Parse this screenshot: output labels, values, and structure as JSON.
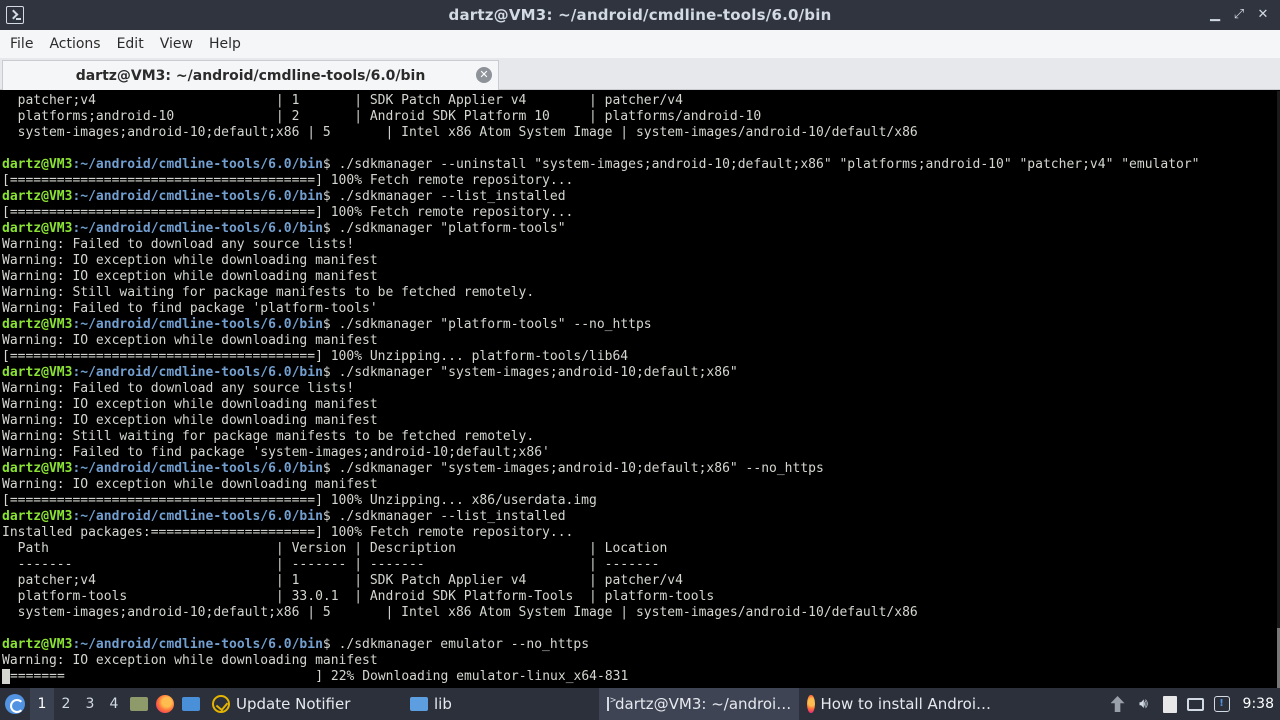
{
  "window": {
    "title": "dartz@VM3: ~/android/cmdline-tools/6.0/bin"
  },
  "menu": {
    "file": "File",
    "actions": "Actions",
    "edit": "Edit",
    "view": "View",
    "help": "Help"
  },
  "tab": {
    "label": "dartz@VM3: ~/android/cmdline-tools/6.0/bin"
  },
  "terminal": {
    "prompt_user": "dartz@VM3",
    "prompt_path": ":~/android/cmdline-tools/6.0/bin",
    "prompt_suffix": "$ ",
    "lines": [
      {
        "kind": "out",
        "text": "  patcher;v4                       | 1       | SDK Patch Applier v4        | patcher/v4"
      },
      {
        "kind": "out",
        "text": "  platforms;android-10             | 2       | Android SDK Platform 10     | platforms/android-10"
      },
      {
        "kind": "out",
        "text": "  system-images;android-10;default;x86 | 5       | Intel x86 Atom System Image | system-images/android-10/default/x86"
      },
      {
        "kind": "out",
        "text": ""
      },
      {
        "kind": "prompt",
        "text": "./sdkmanager --uninstall \"system-images;android-10;default;x86\" \"platforms;android-10\" \"patcher;v4\" \"emulator\""
      },
      {
        "kind": "out",
        "text": "[=======================================] 100% Fetch remote repository..."
      },
      {
        "kind": "prompt",
        "text": "./sdkmanager --list_installed"
      },
      {
        "kind": "out",
        "text": "[=======================================] 100% Fetch remote repository..."
      },
      {
        "kind": "prompt",
        "text": "./sdkmanager \"platform-tools\""
      },
      {
        "kind": "out",
        "text": "Warning: Failed to download any source lists!"
      },
      {
        "kind": "out",
        "text": "Warning: IO exception while downloading manifest"
      },
      {
        "kind": "out",
        "text": "Warning: IO exception while downloading manifest"
      },
      {
        "kind": "out",
        "text": "Warning: Still waiting for package manifests to be fetched remotely."
      },
      {
        "kind": "out",
        "text": "Warning: Failed to find package 'platform-tools'"
      },
      {
        "kind": "prompt",
        "text": "./sdkmanager \"platform-tools\" --no_https"
      },
      {
        "kind": "out",
        "text": "Warning: IO exception while downloading manifest"
      },
      {
        "kind": "out",
        "text": "[=======================================] 100% Unzipping... platform-tools/lib64"
      },
      {
        "kind": "prompt",
        "text": "./sdkmanager \"system-images;android-10;default;x86\""
      },
      {
        "kind": "out",
        "text": "Warning: Failed to download any source lists!"
      },
      {
        "kind": "out",
        "text": "Warning: IO exception while downloading manifest"
      },
      {
        "kind": "out",
        "text": "Warning: IO exception while downloading manifest"
      },
      {
        "kind": "out",
        "text": "Warning: Still waiting for package manifests to be fetched remotely."
      },
      {
        "kind": "out",
        "text": "Warning: Failed to find package 'system-images;android-10;default;x86'"
      },
      {
        "kind": "prompt",
        "text": "./sdkmanager \"system-images;android-10;default;x86\" --no_https"
      },
      {
        "kind": "out",
        "text": "Warning: IO exception while downloading manifest"
      },
      {
        "kind": "out",
        "text": "[=======================================] 100% Unzipping... x86/userdata.img"
      },
      {
        "kind": "prompt",
        "text": "./sdkmanager --list_installed"
      },
      {
        "kind": "out",
        "text": "Installed packages:=====================] 100% Fetch remote repository..."
      },
      {
        "kind": "out",
        "text": "  Path                             | Version | Description                 | Location"
      },
      {
        "kind": "out",
        "text": "  -------                          | ------- | -------                     | -------"
      },
      {
        "kind": "out",
        "text": "  patcher;v4                       | 1       | SDK Patch Applier v4        | patcher/v4"
      },
      {
        "kind": "out",
        "text": "  platform-tools                   | 33.0.1  | Android SDK Platform-Tools  | platform-tools"
      },
      {
        "kind": "out",
        "text": "  system-images;android-10;default;x86 | 5       | Intel x86 Atom System Image | system-images/android-10/default/x86"
      },
      {
        "kind": "out",
        "text": ""
      },
      {
        "kind": "prompt",
        "text": "./sdkmanager emulator --no_https"
      },
      {
        "kind": "out",
        "text": "Warning: IO exception while downloading manifest"
      },
      {
        "kind": "cursor",
        "text": "=======                                ] 22% Downloading emulator-linux_x64-831"
      }
    ]
  },
  "taskbar": {
    "workspaces": [
      "1",
      "2",
      "3",
      "4"
    ],
    "active_workspace": "1",
    "tasks": {
      "update_notifier": "Update Notifier",
      "lib": "lib",
      "terminal": "dartz@VM3: ~/androi…",
      "browser": "How to install Androi…"
    },
    "clock": "9:38"
  }
}
